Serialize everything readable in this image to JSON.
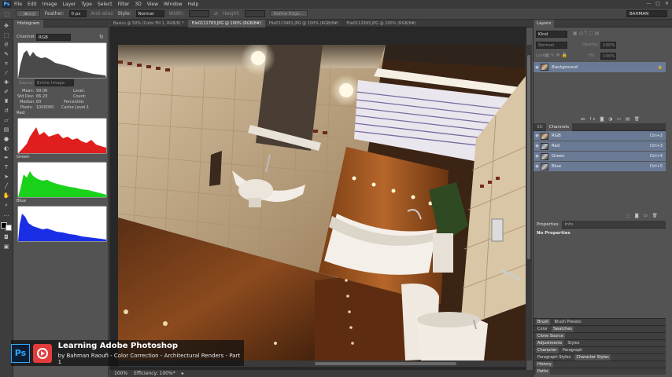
{
  "app": {
    "logo": "Ps",
    "menu": [
      "File",
      "Edit",
      "Image",
      "Layer",
      "Type",
      "Select",
      "Filter",
      "3D",
      "View",
      "Window",
      "Help"
    ],
    "window_controls": [
      "—",
      "□",
      "✕"
    ]
  },
  "options_bar": {
    "feather_label": "Feather:",
    "feather_value": "0 px",
    "anti_alias": "Anti-alias",
    "style_label": "Style:",
    "style_value": "Normal",
    "width_label": "Width:",
    "height_label": "Height:",
    "refine_edge": "Refine Edge...",
    "workspace": "BAHMAN"
  },
  "histogram": {
    "tabs": [
      "Histogram"
    ],
    "channel_label": "Channel:",
    "channel_value": "RGB",
    "source_label": "Source:",
    "source_value": "Entire Image",
    "stats": {
      "mean_label": "Mean:",
      "mean": "99.06",
      "stddev_label": "Std Dev:",
      "stddev": "66.23",
      "median_label": "Median:",
      "median": "83",
      "pixels_label": "Pixels:",
      "pixels": "1000000",
      "level_label": "Level:",
      "count_label": "Count:",
      "percentile_label": "Percentile:",
      "cache_label": "Cache Level:",
      "cache": "1"
    },
    "red_label": "Red",
    "green_label": "Green",
    "blue_label": "Blue"
  },
  "doc_tabs": [
    "Basics @ 50% (Color Fill 1, RGB/8) *",
    "File0111783.JPG @ 100% (RGB/8#)",
    "File0113481.JPG @ 100% (RGB/8#)",
    "File0112993.JPG @ 100% (RGB/8#)"
  ],
  "status": {
    "zoom": "100%",
    "info": "Efficiency: 100%*"
  },
  "layers": {
    "tab": "Layers",
    "kind": "Kind",
    "blend": "Normal",
    "opacity_label": "Opacity:",
    "opacity": "100%",
    "lock_label": "Lock:",
    "fill_label": "Fill:",
    "fill": "100%",
    "items": [
      {
        "name": "Background"
      }
    ]
  },
  "channels": {
    "tabs": [
      "3D",
      "Channels"
    ],
    "items": [
      {
        "name": "RGB",
        "key": "Ctrl+2"
      },
      {
        "name": "Red",
        "key": "Ctrl+3"
      },
      {
        "name": "Green",
        "key": "Ctrl+4"
      },
      {
        "name": "Blue",
        "key": "Ctrl+5"
      }
    ]
  },
  "properties": {
    "tabs": [
      "Properties",
      "Info"
    ],
    "message": "No Properties"
  },
  "collapsed_panels": [
    [
      "Brush",
      "Brush Presets"
    ],
    [
      "Color",
      "Swatches"
    ],
    [
      "Clone Source"
    ],
    [
      "Adjustments",
      "Styles"
    ],
    [
      "Character",
      "Paragraph"
    ],
    [
      "Paragraph Styles",
      "Character Styles"
    ],
    [
      "History"
    ],
    [
      "Paths"
    ]
  ],
  "watermark": {
    "ps": "Ps",
    "title": "Learning Adobe Photoshop",
    "subtitle": "by Bahman Raoufi - Color Correction - Architectural Renders - Part 1"
  }
}
